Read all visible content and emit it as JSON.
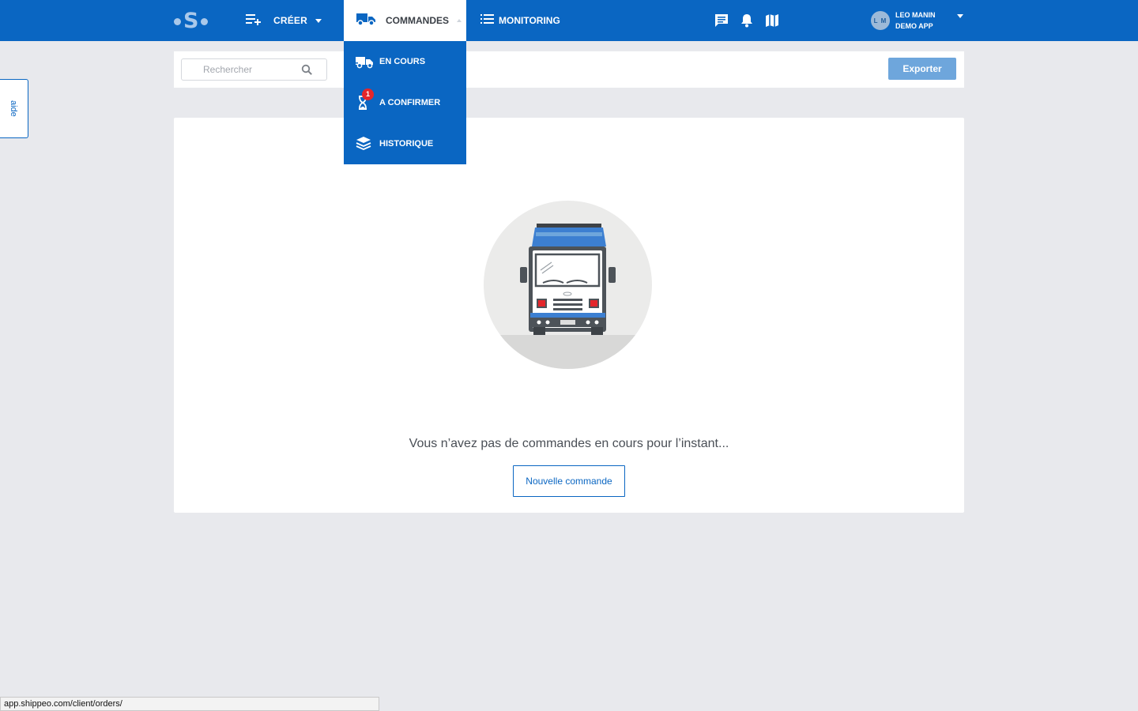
{
  "nav": {
    "creer_label": "CRÉER",
    "commandes_label": "COMMANDES",
    "monitoring_label": "MONITORING",
    "icons": [
      "chat-icon",
      "bell-icon",
      "map-icon"
    ]
  },
  "user": {
    "initials": "L M",
    "name": "LEO MANIN",
    "company": "DEMO APP"
  },
  "dropdown": {
    "items": [
      {
        "label": "EN COURS",
        "icon": "truck-icon"
      },
      {
        "label": "A CONFIRMER",
        "icon": "hourglass-icon",
        "badge": "1"
      },
      {
        "label": "HISTORIQUE",
        "icon": "layers-icon"
      }
    ]
  },
  "search": {
    "placeholder": "Rechercher",
    "value": ""
  },
  "toolbar": {
    "export_label": "Exporter"
  },
  "aide_label": "aide",
  "empty_state": {
    "message": "Vous n’avez pas de commandes en cours pour l’instant...",
    "button_label": "Nouvelle commande"
  },
  "status_url": "app.shippeo.com/client/orders/",
  "colors": {
    "primary": "#0a66c2",
    "export": "#6ea6dc",
    "badge": "#e3262b",
    "background": "#e8e9ed"
  }
}
